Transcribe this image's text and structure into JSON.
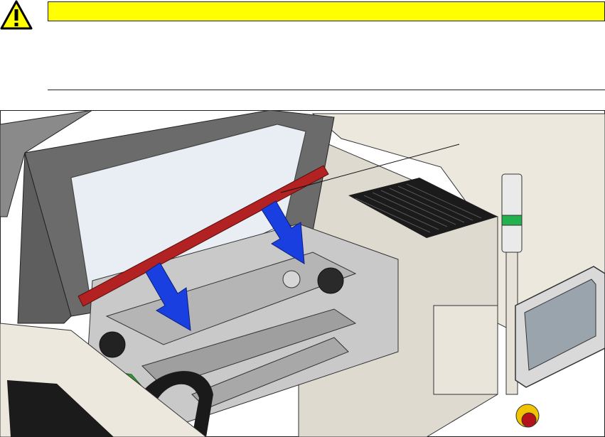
{
  "document": {
    "warning_icon": "warning-triangle-icon",
    "warning_bar_color": "#ffff00",
    "warning_text": ""
  },
  "illustration": {
    "subject": "machine-interior-lid-open",
    "highlight_color": "#b22222",
    "arrow_color": "#1a3fe0",
    "signal_light_green": "#22b14c",
    "callout_count": 1
  }
}
